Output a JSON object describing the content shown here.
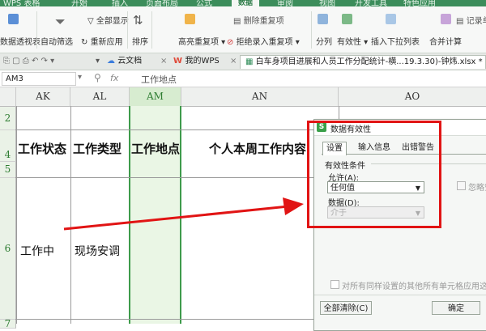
{
  "ribbon_tabs": {
    "app": "WPS 表格",
    "items": [
      "开始",
      "插入",
      "页面布局",
      "公式",
      "数据",
      "审阅",
      "视图",
      "开发工具",
      "特色应用"
    ],
    "active": "数据"
  },
  "ribbon": {
    "pivot": "数据透视表",
    "autofilter": "自动筛选",
    "show_all": "全部显示",
    "reapply": "重新应用",
    "sort": "排序",
    "highlight_dup": "高亮重复项",
    "delete_dup": "删除重复项",
    "reject_dup": "拒绝录入重复项",
    "split": "分列",
    "validity": "有效性",
    "insert_dropdown": "插入下拉列表",
    "merge_calc": "合并计算",
    "record": "记录单",
    "accent_color": "#3c8d5b"
  },
  "doc_tabs": {
    "cloud": "云文档",
    "mywps": "我的WPS",
    "active_file": "白车身项目进展和人员工作分配统计-横...19.3.30)-钟炜.xlsx *"
  },
  "formula_bar": {
    "name_box": "AM3",
    "fx": "fx",
    "content": "工作地点"
  },
  "grid": {
    "columns": [
      "AK",
      "AL",
      "AM",
      "AN",
      "AO"
    ],
    "selected_column": "AM",
    "rows": [
      "2",
      "4",
      "5",
      "6",
      "7"
    ],
    "headers": [
      "工作状态",
      "工作类型",
      "工作地点",
      "个人本周工作内容"
    ],
    "row6": [
      "工作中",
      "现场安调"
    ]
  },
  "dialog": {
    "title": "数据有效性",
    "tabs": [
      "设置",
      "输入信息",
      "出错警告"
    ],
    "active_tab": "设置",
    "section": "有效性条件",
    "allow_label": "允许(A):",
    "allow_value": "任何值",
    "data_label": "数据(D):",
    "data_value": "介于",
    "ignore_blank": "忽略空",
    "apply_all": "对所有同样设置的其他所有单元格应用这些",
    "clear_all": "全部清除(C)",
    "ok": "确定",
    "highlight_color": "#e11414"
  }
}
